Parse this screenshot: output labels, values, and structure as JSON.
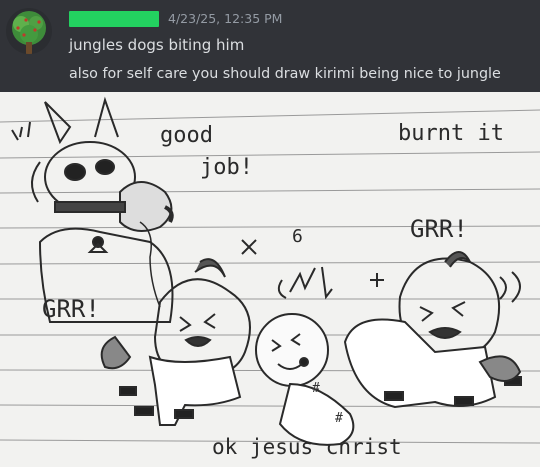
{
  "message": {
    "timestamp": "4/23/25, 12:35 PM",
    "lines": [
      "jungles dogs biting him",
      "also for self care you should draw kirimi being nice to jungle"
    ],
    "username_bar_color": "#23d160",
    "avatar": {
      "icon": "tree-avatar-icon",
      "colors": [
        "#3e8c3a",
        "#5fb04c",
        "#2c6a2a"
      ]
    }
  },
  "drawing": {
    "paper_color": "#f2f2f0",
    "texts": {
      "good": "good",
      "job": "job!",
      "burnt": "burnt it",
      "grr_left": "GRR!",
      "grr_right": "GRR!",
      "six": "6",
      "caption": "ok  jesus christ"
    }
  }
}
